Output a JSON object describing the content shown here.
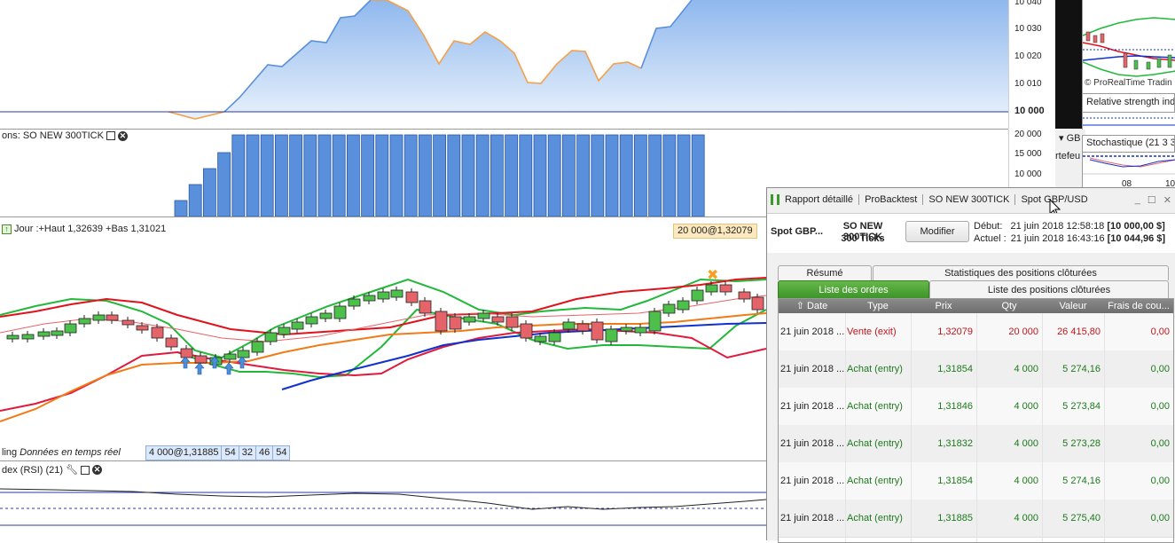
{
  "colors": {
    "up": "#4cc04a",
    "down": "#e5646a",
    "equity_fill": "#9fc4f2",
    "equity_line": "#5a8fdc",
    "equity_under": "#f5a04a",
    "bb_green": "#22b83a",
    "ma_red": "#e1121b",
    "ma_blue": "#1030d0",
    "ma_orange": "#f07b17",
    "up_arrow": "#4a8fdc",
    "sell_marker": "#f5a020",
    "buy_text": "#1c7a1c",
    "sell_text": "#c0151c"
  },
  "equity_scale": [
    "10 040",
    "10 030",
    "10 020",
    "10 010",
    "10 000"
  ],
  "position_scale": [
    "20 000",
    "15 000",
    "10 000"
  ],
  "position_pane": {
    "label": "ons: SO NEW 300TICK"
  },
  "price_pane": {
    "header": "Jour :+Haut 1,32639 +Bas 1,31021",
    "exit_badge": "20 000@1,32079",
    "footer_left": "ling",
    "footer_italic": "Données en temps réel",
    "position_badge": [
      "4 000@1,31885",
      "54",
      "32",
      "46",
      "54"
    ]
  },
  "rsi_pane": {
    "label": "dex (RSI) (21)"
  },
  "right_strip": {
    "watermark": "© ProRealTime Tradin",
    "rsi_label": "Relative strength indi",
    "gb_label": "GB",
    "tefeu_label": "rtefeu",
    "stoch_label": "Stochastique (21 3 3",
    "axis_08": "08",
    "axis_10": "10"
  },
  "backtest": {
    "tabs": [
      "Rapport détaillé",
      "ProBacktest",
      "SO NEW 300TICK",
      "Spot GBP/USD"
    ],
    "instrument": "Spot GBP...",
    "strategy": "SO NEW 300TICK",
    "period": "300 Ticks",
    "modify_label": "Modifier",
    "debut_label": "Début:",
    "debut_value": "21 juin 2018 12:58:18",
    "debut_capital": "[10 000,00 $]",
    "actuel_label": "Actuel :",
    "actuel_value": "21 juin 2018 16:43:16",
    "actuel_capital": "[10 044,96 $]",
    "upper_tabs": [
      "Résumé",
      "Statistiques des positions clôturées"
    ],
    "lower_tabs": [
      "Liste des ordres",
      "Liste des positions clôturées"
    ],
    "columns": [
      "Date",
      "Type",
      "Prix",
      "Qty",
      "Valeur",
      "Frais de cou..."
    ],
    "rows": [
      {
        "date": "21 juin 2018 ...",
        "type": "Vente (exit)",
        "prix": "1,32079",
        "qty": "20 000",
        "valeur": "26 415,80",
        "frais": "0,00",
        "kind": "sell"
      },
      {
        "date": "21 juin 2018 ...",
        "type": "Achat (entry)",
        "prix": "1,31854",
        "qty": "4 000",
        "valeur": "5 274,16",
        "frais": "0,00",
        "kind": "buy"
      },
      {
        "date": "21 juin 2018 ...",
        "type": "Achat (entry)",
        "prix": "1,31846",
        "qty": "4 000",
        "valeur": "5 273,84",
        "frais": "0,00",
        "kind": "buy"
      },
      {
        "date": "21 juin 2018 ...",
        "type": "Achat (entry)",
        "prix": "1,31832",
        "qty": "4 000",
        "valeur": "5 273,28",
        "frais": "0,00",
        "kind": "buy"
      },
      {
        "date": "21 juin 2018 ...",
        "type": "Achat (entry)",
        "prix": "1,31854",
        "qty": "4 000",
        "valeur": "5 274,16",
        "frais": "0,00",
        "kind": "buy"
      },
      {
        "date": "21 juin 2018 ...",
        "type": "Achat (entry)",
        "prix": "1,31885",
        "qty": "4 000",
        "valeur": "5 275,40",
        "frais": "0,00",
        "kind": "buy"
      }
    ]
  }
}
